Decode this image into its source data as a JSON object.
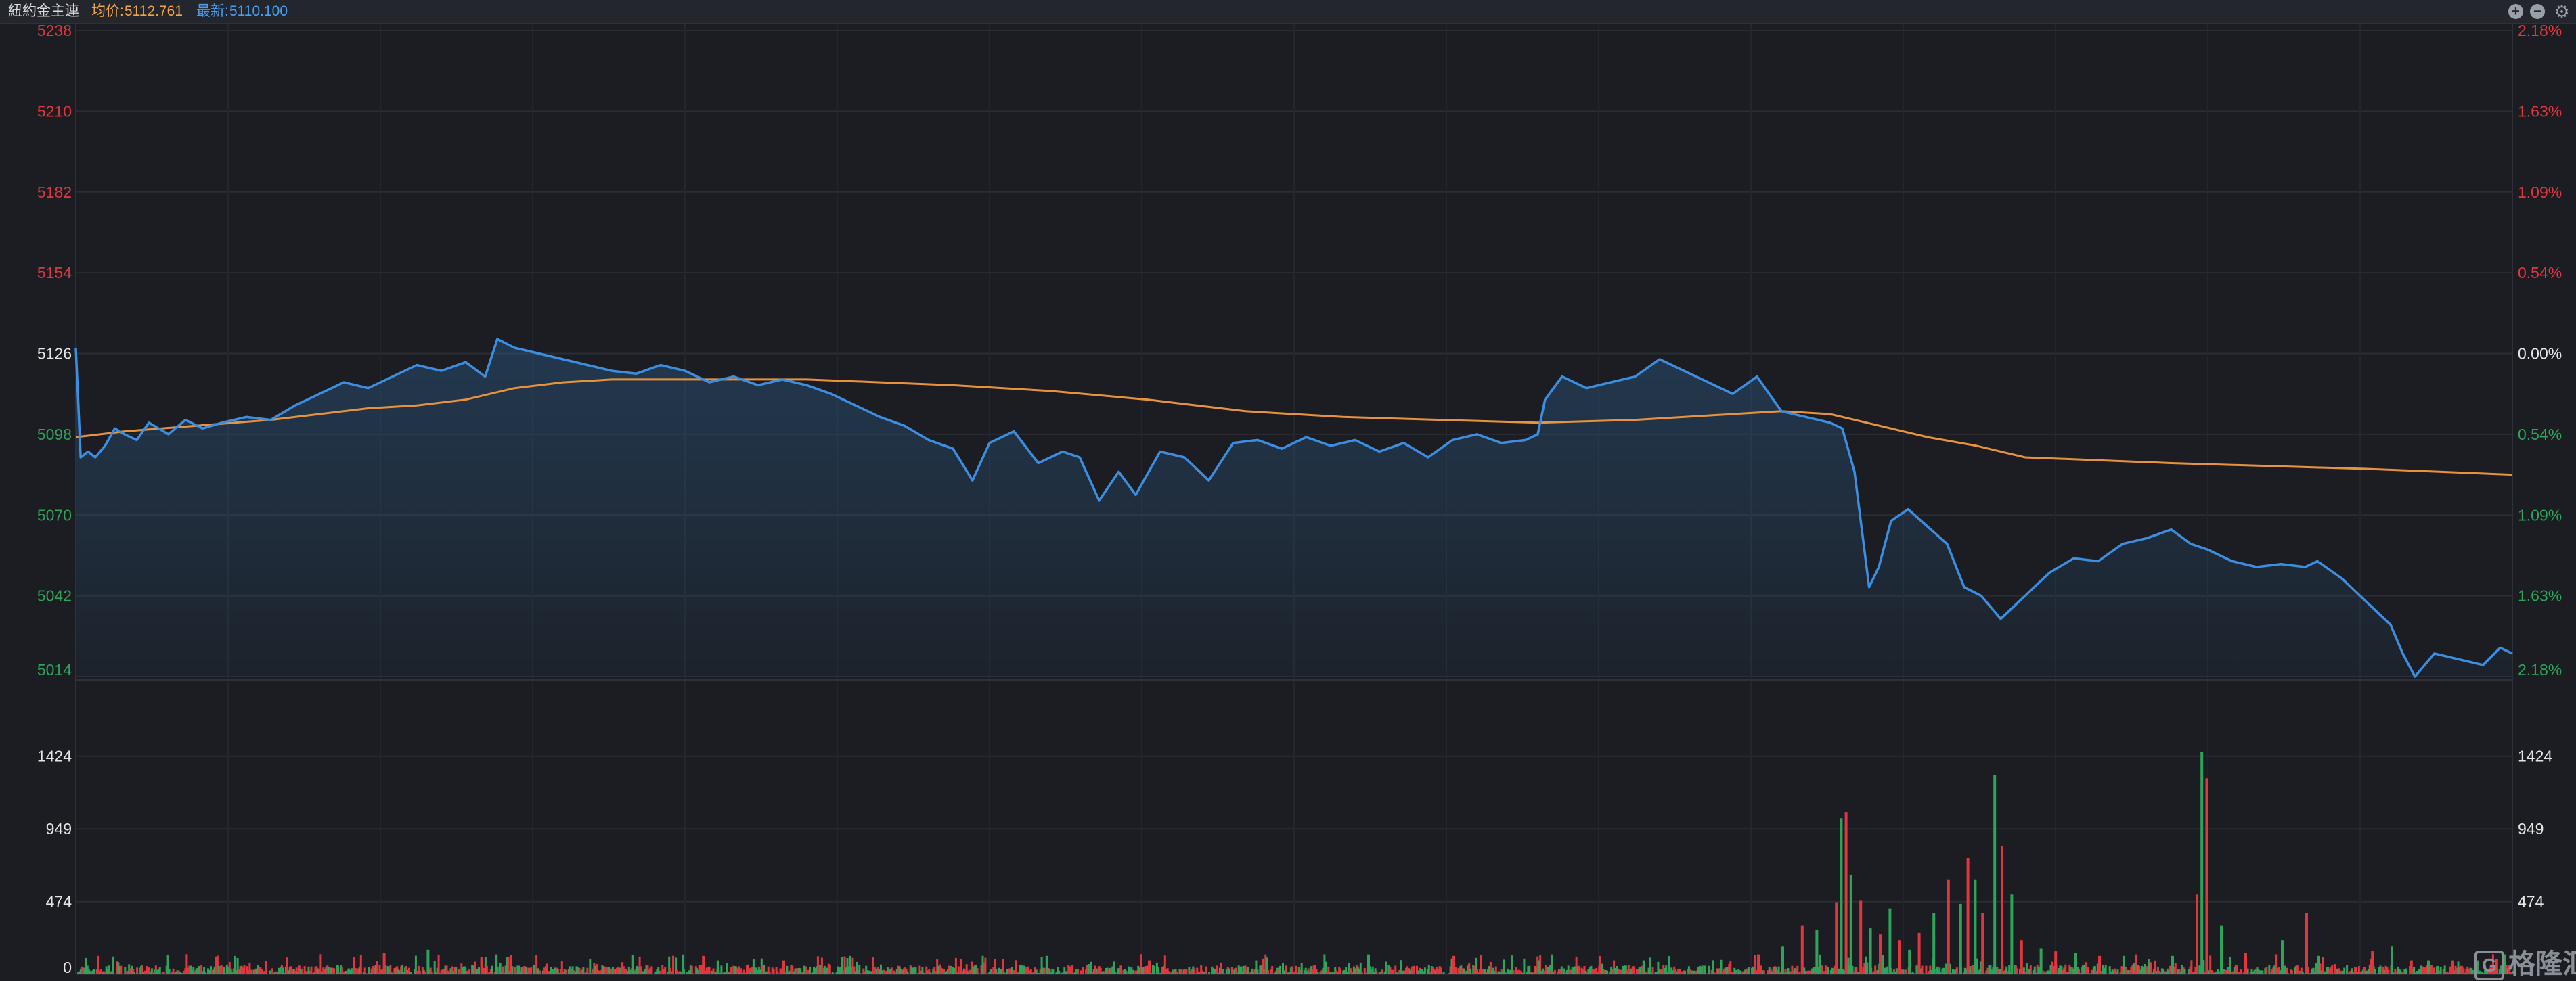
{
  "header": {
    "title": "紐約金主連",
    "avg_label": "均价:",
    "avg_value": "5112.761",
    "last_label": "最新:",
    "last_value": "5110.100"
  },
  "watermark": "格隆汇",
  "colors": {
    "background": "#1b1d22",
    "price_line": "#3d8ee0",
    "avg_line": "#e8933c",
    "up": "#e2353d",
    "down": "#2ea35a",
    "neutral": "#e6e6e6",
    "grid": "#2a2d33"
  },
  "chart_data": {
    "type": "line",
    "title": "紐約金主連",
    "x_label": "",
    "y_label": "",
    "price_axis": {
      "ticks": [
        5238,
        5210,
        5182,
        5154,
        5126,
        5098,
        5070,
        5042,
        5014
      ],
      "labels": [
        "5238",
        "5210",
        "5182",
        "5154",
        "5126",
        "5098",
        "5070",
        "5042",
        "5014"
      ],
      "pct_labels": [
        "2.18%",
        "1.63%",
        "1.09%",
        "0.54%",
        "0.00%",
        "0.54%",
        "1.09%",
        "1.63%",
        "2.18%"
      ],
      "ylim": [
        5014,
        5238
      ],
      "base": 5126
    },
    "volume_axis": {
      "ticks": [
        1424,
        949,
        474,
        0
      ],
      "labels": [
        "1424",
        "949",
        "474",
        "0"
      ],
      "ylim": [
        0,
        1900
      ]
    },
    "x": {
      "start": 0,
      "end": 1000
    },
    "series": [
      {
        "role": "price",
        "points": [
          [
            0,
            5128
          ],
          [
            2,
            5090
          ],
          [
            5,
            5092
          ],
          [
            8,
            5090
          ],
          [
            12,
            5094
          ],
          [
            16,
            5100
          ],
          [
            20,
            5098
          ],
          [
            25,
            5096
          ],
          [
            30,
            5102
          ],
          [
            38,
            5098
          ],
          [
            45,
            5103
          ],
          [
            52,
            5100
          ],
          [
            60,
            5102
          ],
          [
            70,
            5104
          ],
          [
            80,
            5103
          ],
          [
            90,
            5108
          ],
          [
            100,
            5112
          ],
          [
            110,
            5116
          ],
          [
            120,
            5114
          ],
          [
            130,
            5118
          ],
          [
            140,
            5122
          ],
          [
            150,
            5120
          ],
          [
            160,
            5123
          ],
          [
            168,
            5118
          ],
          [
            173,
            5131
          ],
          [
            180,
            5128
          ],
          [
            190,
            5126
          ],
          [
            200,
            5124
          ],
          [
            210,
            5122
          ],
          [
            220,
            5120
          ],
          [
            230,
            5119
          ],
          [
            240,
            5122
          ],
          [
            250,
            5120
          ],
          [
            260,
            5116
          ],
          [
            270,
            5118
          ],
          [
            280,
            5115
          ],
          [
            290,
            5117
          ],
          [
            300,
            5115
          ],
          [
            310,
            5112
          ],
          [
            320,
            5108
          ],
          [
            330,
            5104
          ],
          [
            340,
            5101
          ],
          [
            350,
            5096
          ],
          [
            360,
            5093
          ],
          [
            368,
            5082
          ],
          [
            375,
            5095
          ],
          [
            385,
            5099
          ],
          [
            395,
            5088
          ],
          [
            405,
            5092
          ],
          [
            412,
            5090
          ],
          [
            420,
            5075
          ],
          [
            428,
            5085
          ],
          [
            435,
            5077
          ],
          [
            445,
            5092
          ],
          [
            455,
            5090
          ],
          [
            465,
            5082
          ],
          [
            475,
            5095
          ],
          [
            485,
            5096
          ],
          [
            495,
            5093
          ],
          [
            505,
            5097
          ],
          [
            515,
            5094
          ],
          [
            525,
            5096
          ],
          [
            535,
            5092
          ],
          [
            545,
            5095
          ],
          [
            555,
            5090
          ],
          [
            565,
            5096
          ],
          [
            575,
            5098
          ],
          [
            585,
            5095
          ],
          [
            595,
            5096
          ],
          [
            600,
            5098
          ],
          [
            603,
            5110
          ],
          [
            610,
            5118
          ],
          [
            620,
            5114
          ],
          [
            630,
            5116
          ],
          [
            640,
            5118
          ],
          [
            650,
            5124
          ],
          [
            660,
            5120
          ],
          [
            670,
            5116
          ],
          [
            680,
            5112
          ],
          [
            690,
            5118
          ],
          [
            700,
            5106
          ],
          [
            710,
            5104
          ],
          [
            720,
            5102
          ],
          [
            725,
            5100
          ],
          [
            730,
            5085
          ],
          [
            733,
            5065
          ],
          [
            736,
            5045
          ],
          [
            740,
            5052
          ],
          [
            745,
            5068
          ],
          [
            752,
            5072
          ],
          [
            760,
            5066
          ],
          [
            768,
            5060
          ],
          [
            775,
            5045
          ],
          [
            782,
            5042
          ],
          [
            790,
            5034
          ],
          [
            800,
            5042
          ],
          [
            810,
            5050
          ],
          [
            820,
            5055
          ],
          [
            830,
            5054
          ],
          [
            840,
            5060
          ],
          [
            850,
            5062
          ],
          [
            860,
            5065
          ],
          [
            868,
            5060
          ],
          [
            875,
            5058
          ],
          [
            885,
            5054
          ],
          [
            895,
            5052
          ],
          [
            905,
            5053
          ],
          [
            915,
            5052
          ],
          [
            920,
            5054
          ],
          [
            930,
            5048
          ],
          [
            940,
            5040
          ],
          [
            950,
            5032
          ],
          [
            955,
            5022
          ],
          [
            960,
            5014
          ],
          [
            968,
            5022
          ],
          [
            978,
            5020
          ],
          [
            988,
            5018
          ],
          [
            995,
            5024
          ],
          [
            1000,
            5022
          ]
        ]
      },
      {
        "role": "average",
        "points": [
          [
            0,
            5097
          ],
          [
            20,
            5099
          ],
          [
            50,
            5101
          ],
          [
            80,
            5103
          ],
          [
            100,
            5105
          ],
          [
            120,
            5107
          ],
          [
            140,
            5108
          ],
          [
            160,
            5110
          ],
          [
            180,
            5114
          ],
          [
            200,
            5116
          ],
          [
            220,
            5117
          ],
          [
            260,
            5117
          ],
          [
            300,
            5117
          ],
          [
            330,
            5116
          ],
          [
            360,
            5115
          ],
          [
            400,
            5113
          ],
          [
            440,
            5110
          ],
          [
            480,
            5106
          ],
          [
            520,
            5104
          ],
          [
            560,
            5103
          ],
          [
            600,
            5102
          ],
          [
            640,
            5103
          ],
          [
            680,
            5105
          ],
          [
            700,
            5106
          ],
          [
            720,
            5105
          ],
          [
            740,
            5101
          ],
          [
            760,
            5097
          ],
          [
            780,
            5094
          ],
          [
            800,
            5090
          ],
          [
            830,
            5089
          ],
          [
            860,
            5088
          ],
          [
            900,
            5087
          ],
          [
            940,
            5086
          ],
          [
            970,
            5085
          ],
          [
            1000,
            5084
          ]
        ]
      }
    ],
    "volume": {
      "baseline_band": [
        0,
        60
      ],
      "spikes": [
        [
          126,
          140
        ],
        [
          144,
          160
        ],
        [
          166,
          110
        ],
        [
          172,
          130
        ],
        [
          257,
          120
        ],
        [
          263,
          90
        ],
        [
          290,
          90
        ],
        [
          320,
          80
        ],
        [
          380,
          100
        ],
        [
          398,
          120
        ],
        [
          440,
          90
        ],
        [
          530,
          130
        ],
        [
          565,
          120
        ],
        [
          600,
          90
        ],
        [
          625,
          120
        ],
        [
          643,
          90
        ],
        [
          690,
          130
        ],
        [
          700,
          180
        ],
        [
          708,
          320
        ],
        [
          714,
          290
        ],
        [
          722,
          470
        ],
        [
          724,
          1020
        ],
        [
          726,
          1060
        ],
        [
          728,
          650
        ],
        [
          732,
          480
        ],
        [
          736,
          300
        ],
        [
          740,
          260
        ],
        [
          744,
          430
        ],
        [
          748,
          220
        ],
        [
          752,
          160
        ],
        [
          756,
          270
        ],
        [
          762,
          400
        ],
        [
          768,
          620
        ],
        [
          773,
          460
        ],
        [
          776,
          760
        ],
        [
          779,
          620
        ],
        [
          782,
          400
        ],
        [
          787,
          1300
        ],
        [
          790,
          840
        ],
        [
          794,
          520
        ],
        [
          798,
          220
        ],
        [
          806,
          170
        ],
        [
          812,
          150
        ],
        [
          820,
          140
        ],
        [
          830,
          120
        ],
        [
          840,
          120
        ],
        [
          845,
          130
        ],
        [
          860,
          120
        ],
        [
          870,
          520
        ],
        [
          872,
          1450
        ],
        [
          874,
          1280
        ],
        [
          880,
          320
        ],
        [
          890,
          140
        ],
        [
          905,
          220
        ],
        [
          915,
          400
        ],
        [
          920,
          120
        ],
        [
          942,
          150
        ],
        [
          950,
          180
        ],
        [
          958,
          90
        ],
        [
          965,
          90
        ],
        [
          975,
          90
        ],
        [
          985,
          90
        ],
        [
          993,
          100
        ]
      ]
    }
  }
}
